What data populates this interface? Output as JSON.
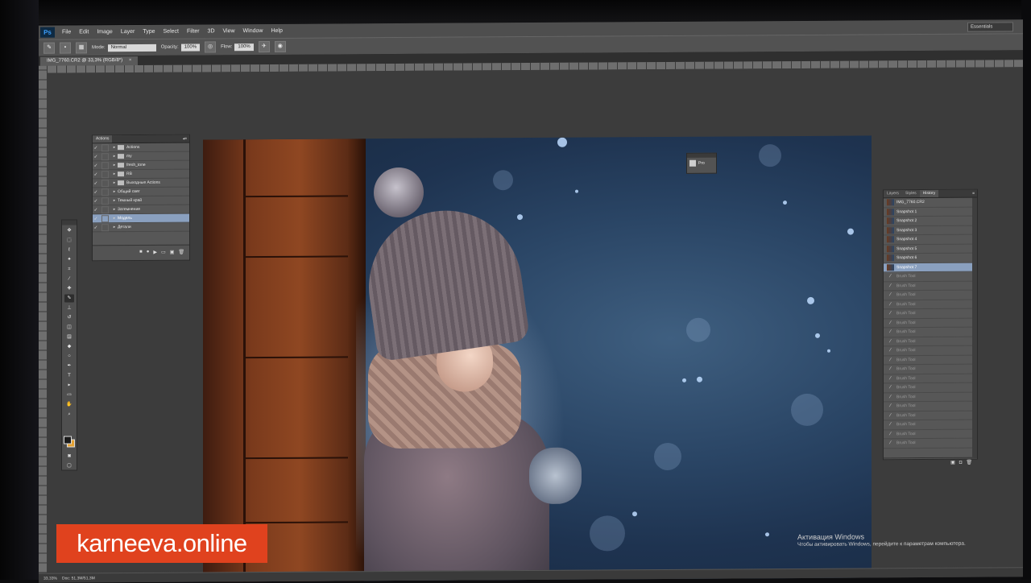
{
  "app": {
    "logo": "Ps",
    "menu": [
      "File",
      "Edit",
      "Image",
      "Layer",
      "Type",
      "Select",
      "Filter",
      "3D",
      "View",
      "Window",
      "Help"
    ],
    "workspace": "Essentials"
  },
  "options": {
    "mode_label": "Mode:",
    "mode_value": "Normal",
    "opacity_label": "Opacity:",
    "opacity_value": "100%",
    "flow_label": "Flow:",
    "flow_value": "100%"
  },
  "document": {
    "tab_title": "IMG_7760.CR2 @ 33,3% (RGB/8*)"
  },
  "actions_panel": {
    "tab": "Actions",
    "items": [
      {
        "label": "Actions",
        "type": "folder"
      },
      {
        "label": "my",
        "type": "folder"
      },
      {
        "label": "fresh_tone",
        "type": "folder"
      },
      {
        "label": "RB",
        "type": "folder"
      },
      {
        "label": "Выходные Actions",
        "type": "folder"
      },
      {
        "label": "Общий свет",
        "type": "action"
      },
      {
        "label": "Темный край",
        "type": "action"
      },
      {
        "label": "Затемнение",
        "type": "action"
      },
      {
        "label": "Модель",
        "type": "action"
      },
      {
        "label": "Детали",
        "type": "action"
      }
    ],
    "selected_index": 8
  },
  "mini_widget": {
    "label": "Pro"
  },
  "history_panel": {
    "tabs": [
      "Layers",
      "Styles",
      "History"
    ],
    "active_tab": "History",
    "file": "IMG_7760.CR2",
    "snapshots": [
      "Snapshot 1",
      "Snapshot 2",
      "Snapshot 3",
      "Snapshot 4",
      "Snapshot 5",
      "Snapshot 6",
      "Snapshot 7"
    ],
    "selected_snapshot": 6,
    "steps_label": "Brush Tool",
    "steps_count": 19
  },
  "statusbar": {
    "zoom": "33,33%",
    "doc": "Doc: 51,3M/51,3M"
  },
  "activation": {
    "title": "Активация Windows",
    "subtitle": "Чтобы активировать Windows, перейдите к параметрам компьютера."
  },
  "brand": {
    "text": "karneeva.online"
  },
  "colors": {
    "brand_bg": "#e0421e",
    "foreground_swatch": "#1b1b1b",
    "background_swatch": "#e5a233",
    "selection": "#8aa0bf"
  }
}
